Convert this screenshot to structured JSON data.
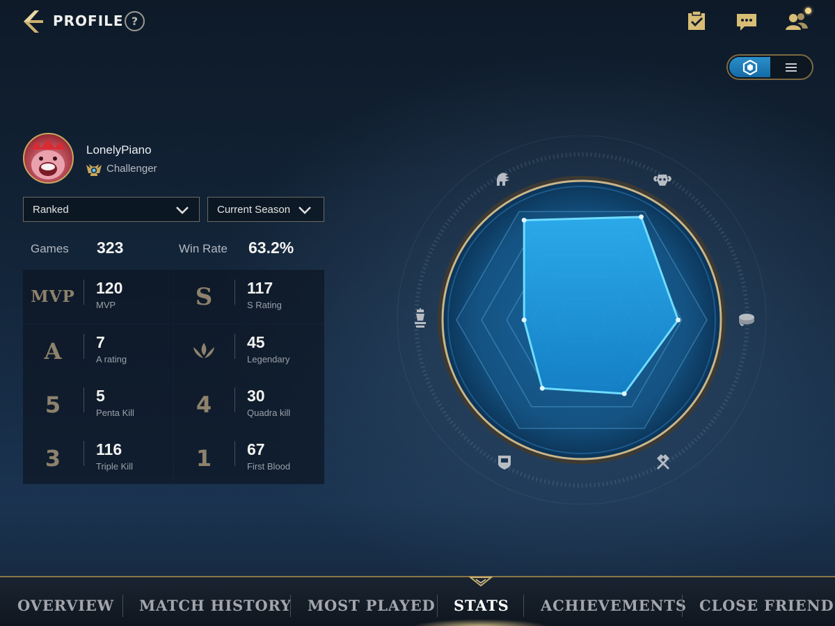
{
  "header": {
    "title": "PROFILE",
    "help_label": "?"
  },
  "icons": {
    "back": "back-chevron-icon",
    "help": "help-circle-icon",
    "missions": "clipboard-check-icon",
    "chat": "chat-bubble-icon",
    "friends": "friends-icon",
    "view_radar": "hexagon-icon",
    "view_list": "list-icon"
  },
  "player": {
    "name": "LonelyPiano",
    "rank": "Challenger"
  },
  "filters": {
    "queue": "Ranked",
    "season": "Current Season"
  },
  "summary": {
    "games_label": "Games",
    "games_value": "323",
    "winrate_label": "Win Rate",
    "winrate_value": "63.2%"
  },
  "stats": [
    {
      "icon_text": "MVP",
      "icon": "mvp-badge-icon",
      "value": "120",
      "label": "MVP"
    },
    {
      "icon_text": "S",
      "icon": "s-rating-icon",
      "value": "117",
      "label": "S Rating"
    },
    {
      "icon_text": "A",
      "icon": "a-rating-icon",
      "value": "7",
      "label": "A rating"
    },
    {
      "icon_text": "",
      "icon": "legendary-crown-icon",
      "value": "45",
      "label": "Legendary"
    },
    {
      "icon_text": "5",
      "icon": "penta-kill-icon",
      "value": "5",
      "label": "Penta Kill"
    },
    {
      "icon_text": "4",
      "icon": "quadra-kill-icon",
      "value": "30",
      "label": "Quadra kill"
    },
    {
      "icon_text": "3",
      "icon": "triple-kill-icon",
      "value": "116",
      "label": "Triple Kill"
    },
    {
      "icon_text": "1",
      "icon": "first-blood-icon",
      "value": "67",
      "label": "First Blood"
    }
  ],
  "radar": {
    "axes": [
      {
        "icon": "helmet-icon"
      },
      {
        "icon": "ram-skull-icon"
      },
      {
        "icon": "coin-stack-icon"
      },
      {
        "icon": "crossed-hammers-icon"
      },
      {
        "icon": "shield-icon"
      },
      {
        "icon": "chess-piece-icon"
      }
    ],
    "values": [
      0.92,
      0.95,
      0.77,
      0.68,
      0.63,
      0.46
    ]
  },
  "nav": {
    "tabs": [
      "OVERVIEW",
      "MATCH HISTORY",
      "MOST PLAYED",
      "STATS",
      "ACHIEVEMENTS",
      "CLOSE FRIENDS"
    ],
    "active": "STATS"
  },
  "colors": {
    "gold_accent": "#c8a860",
    "radar_fill": "#1d9be0",
    "radar_stroke": "#5fd2ff",
    "toggle_active": "#2b8fc9"
  }
}
